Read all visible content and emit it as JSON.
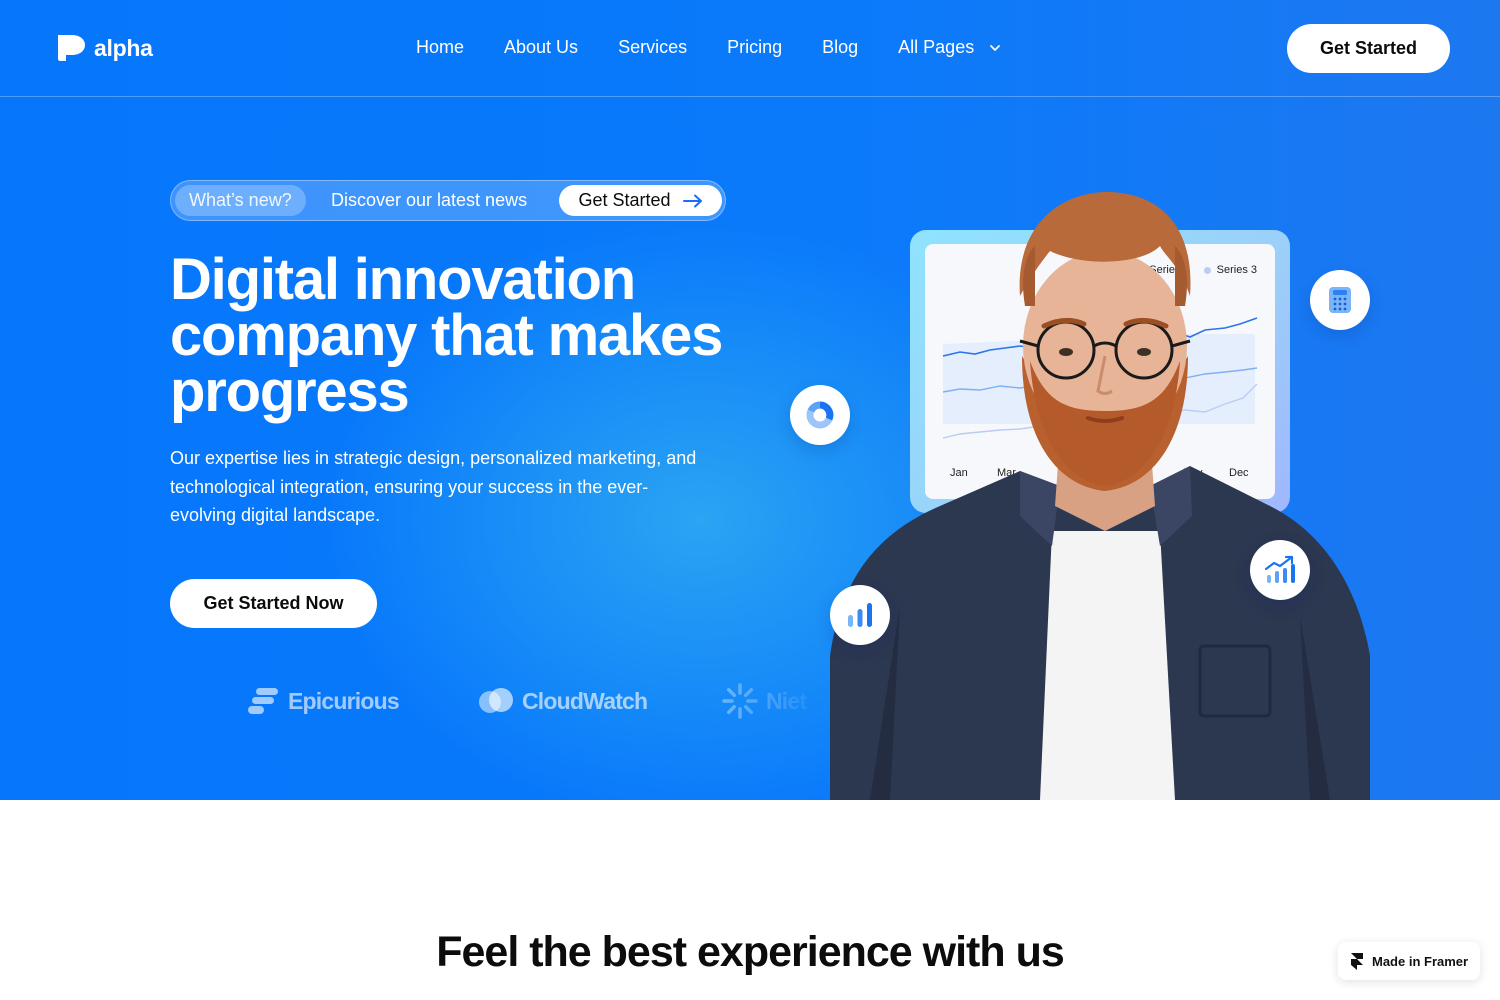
{
  "header": {
    "brand": "alpha",
    "nav": [
      {
        "label": "Home"
      },
      {
        "label": "About Us"
      },
      {
        "label": "Services"
      },
      {
        "label": "Pricing"
      },
      {
        "label": "Blog"
      },
      {
        "label": "All Pages",
        "icon": "chevron-down-icon"
      }
    ],
    "cta_label": "Get Started"
  },
  "hero": {
    "announcement": {
      "tag": "What’s new?",
      "text": "Discover our latest news",
      "button_label": "Get Started",
      "button_icon": "arrow-right-icon"
    },
    "title": "Digital innovation company that makes progress",
    "description": "Our expertise lies in strategic design, personalized marketing, and technological integration, ensuring your success in the ever-evolving digital landscape.",
    "cta_label": "Get Started Now",
    "brands": [
      "Epicurious",
      "CloudWatch",
      "Niet"
    ]
  },
  "chart_card": {
    "legend": [
      "Series 2",
      "Series 3"
    ],
    "months": [
      "Jan",
      "Mar",
      "Nov",
      "Dec"
    ]
  },
  "floating_icons": [
    "donut-chart-icon",
    "bar-chart-icon",
    "calculator-icon",
    "trend-up-icon"
  ],
  "section": {
    "title": "Feel the best experience with us"
  },
  "framer_badge": {
    "label": "Made in Framer",
    "icon": "framer-logo-icon"
  },
  "colors": {
    "primary_blue": "#0a7afb",
    "white": "#ffffff",
    "text_dark": "#0c0c0c"
  }
}
